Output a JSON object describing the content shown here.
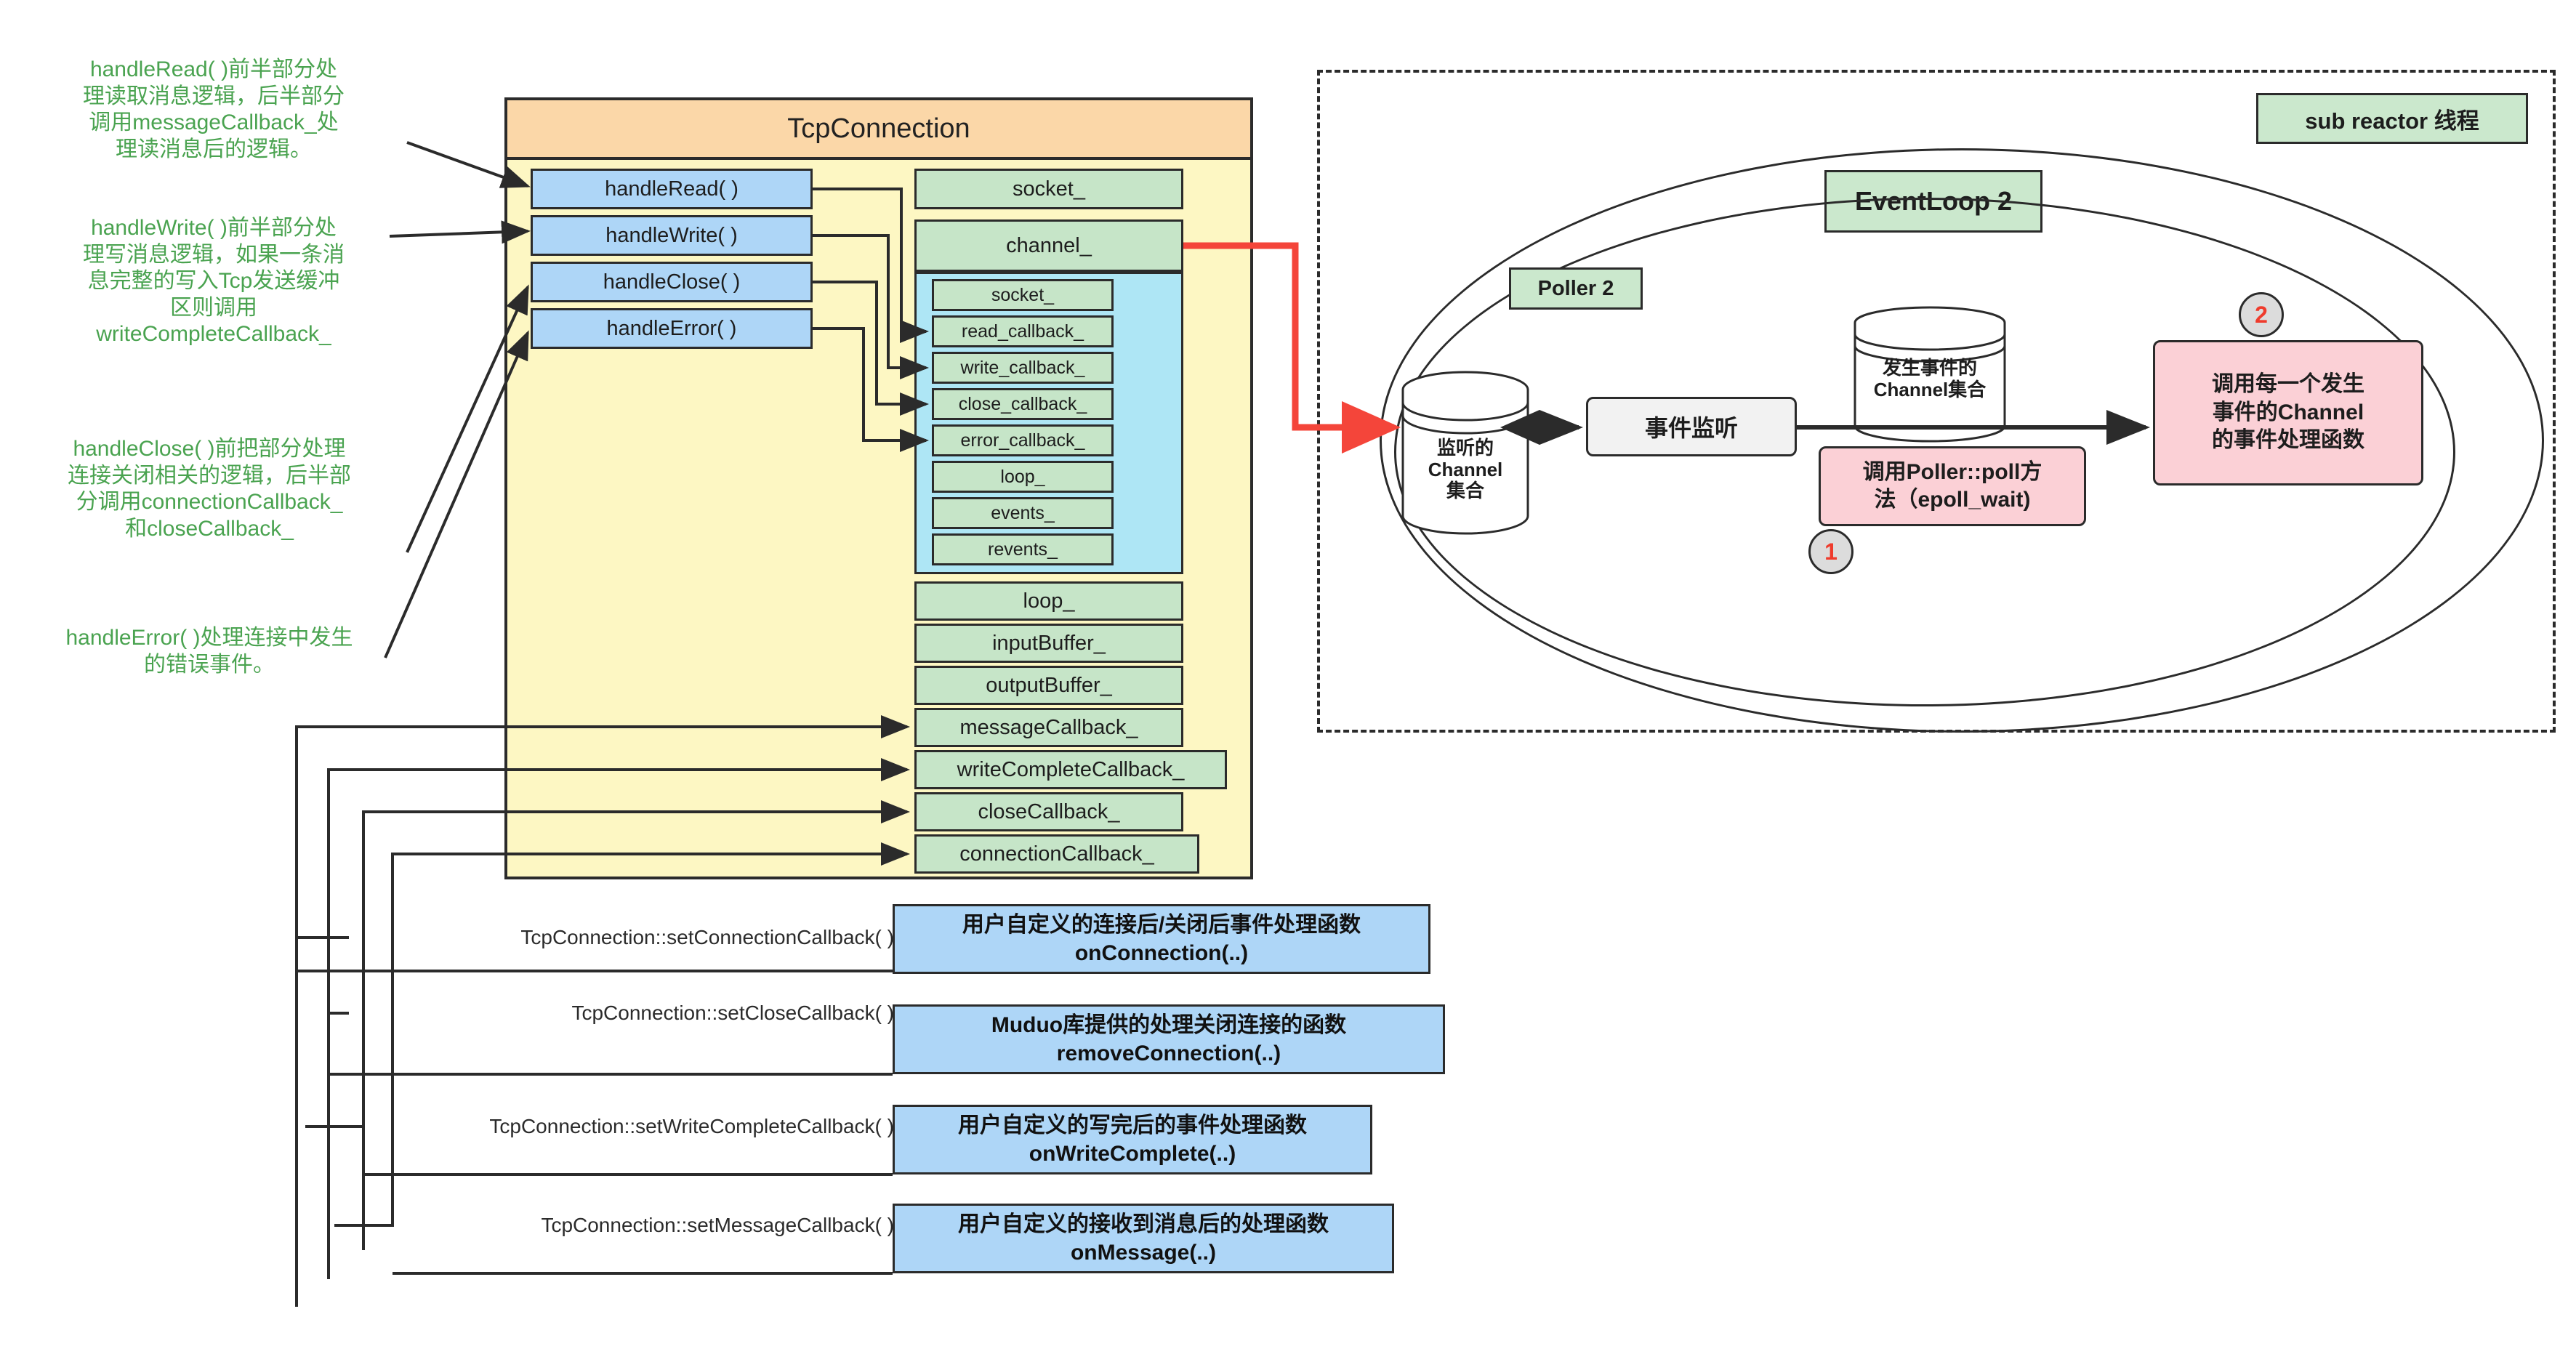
{
  "notes": [
    {
      "text": "handleRead( )前半部分处\n理读取消息逻辑，后半部分\n调用messageCallback_处\n理读消息后的逻辑。"
    },
    {
      "text": "handleWrite( )前半部分处\n理写消息逻辑，如果一条消\n息完整的写入Tcp发送缓冲\n区则调用\nwriteCompleteCallback_"
    },
    {
      "text": "handleClose( )前把部分处理\n连接关闭相关的逻辑，后半部\n分调用connectionCallback_\n和closeCallback_"
    },
    {
      "text": "handleError( )处理连接中发生\n的错误事件。"
    }
  ],
  "tcp": {
    "title": "TcpConnection",
    "methods": [
      "handleRead( )",
      "handleWrite( )",
      "handleClose( )",
      "handleError( )"
    ],
    "members_top": [
      "socket_",
      "channel_"
    ],
    "channel_members": [
      "socket_",
      "read_callback_",
      "write_callback_",
      "close_callback_",
      "error_callback_",
      "loop_",
      "events_",
      "revents_"
    ],
    "members_bottom": [
      "loop_",
      "inputBuffer_",
      "outputBuffer_",
      "messageCallback_",
      "writeCompleteCallback_",
      "closeCallback_",
      "connectionCallback_"
    ]
  },
  "reactor": {
    "thread_tag": "sub reactor 线程",
    "eventloop": "EventLoop 2",
    "poller": "Poller 2",
    "watched_channels": "监听的\nChannel\n集合",
    "event_listen": "事件监听",
    "fired_channels": "发生事件的\nChannel集合",
    "step1_badge": "1",
    "step1_text": "调用Poller::poll方\n法（epoll_wait)",
    "step2_badge": "2",
    "step2_text": "调用每一个发生\n事件的Channel\n的事件处理函数"
  },
  "setters": [
    {
      "label": "TcpConnection::setConnectionCallback( )",
      "box": "用户自定义的连接后/关闭后事件处理函数\nonConnection(..)"
    },
    {
      "label": "TcpConnection::setCloseCallback( )",
      "box": "Muduo库提供的处理关闭连接的函数\nremoveConnection(..)"
    },
    {
      "label": "TcpConnection::setWriteCompleteCallback( )",
      "box": "用户自定义的写完后的事件处理函数\nonWriteComplete(..)"
    },
    {
      "label": "TcpConnection::setMessageCallback( )",
      "box": "用户自定义的接收到消息后的处理函数\nonMessage(..)"
    }
  ],
  "colors": {
    "note_green": "#4aa350",
    "header_orange": "#fbd7a8",
    "panel_yellow": "#fdf7c3",
    "method_blue": "#aed6f7",
    "member_green": "#c6e5c8",
    "channel_cyan": "#aee6f5",
    "pink": "#fbd0d6",
    "tag_green": "#cbe8cd",
    "red_link": "#f4453a",
    "badge_red": "#ef3b2c",
    "stroke": "#2b2b2b"
  }
}
